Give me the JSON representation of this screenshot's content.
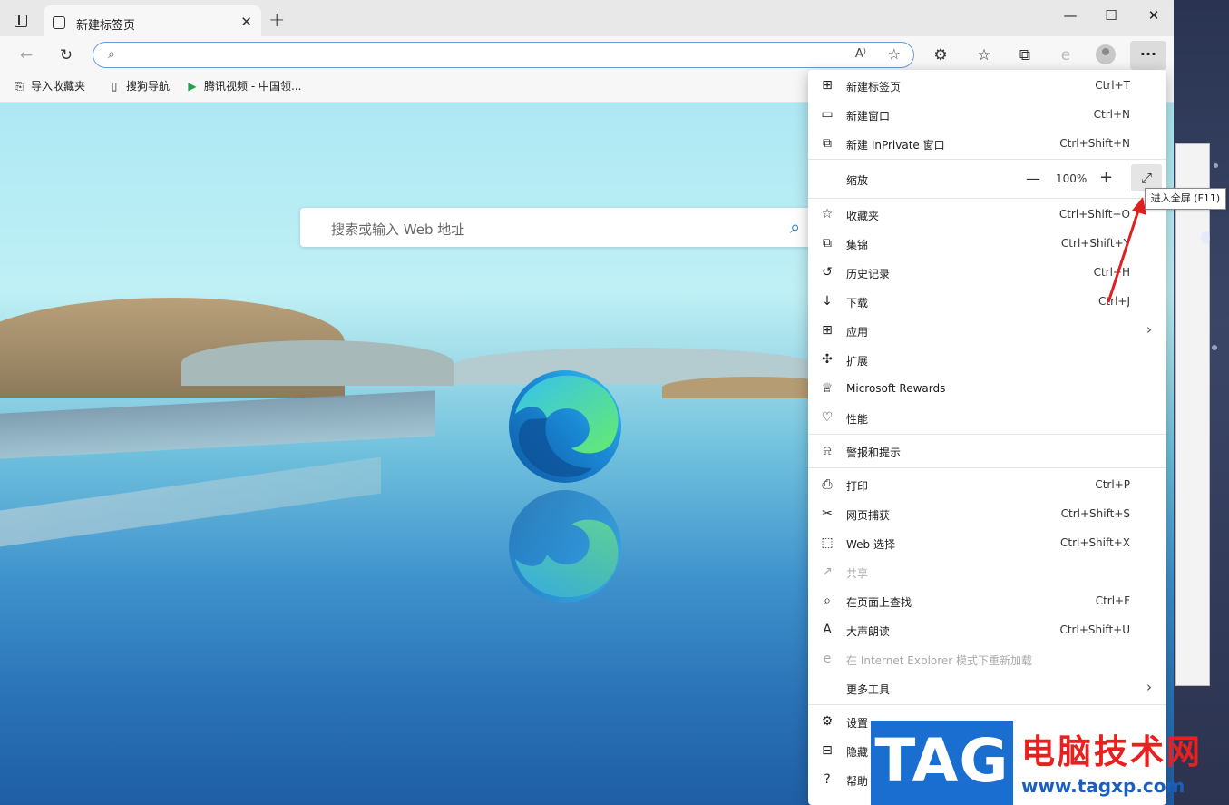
{
  "titlebar": {
    "tab_title": "新建标签页",
    "tab_close": "✕",
    "new_tab": "+",
    "minimize": "—",
    "maximize": "☐",
    "close": "✕"
  },
  "toolbar": {
    "back": "←",
    "refresh": "↻",
    "address_placeholder": "",
    "read_aloud": "A⁾",
    "favorite_add": "☆",
    "extensions": "⚙",
    "favorites": "☆",
    "collections": "⧉",
    "more": "···"
  },
  "bookmarks": [
    {
      "icon": "import-favorites-icon",
      "label": "导入收藏夹"
    },
    {
      "icon": "page-icon",
      "label": "搜狗导航"
    },
    {
      "icon": "tencent-video-icon",
      "label": "腾讯视频 - 中国领..."
    }
  ],
  "newtab": {
    "search_placeholder": "搜索或输入 Web 地址"
  },
  "menu": {
    "items_top": [
      {
        "icon": "new-tab-icon",
        "glyph": "⊞",
        "label": "新建标签页",
        "shortcut": "Ctrl+T"
      },
      {
        "icon": "new-window-icon",
        "glyph": "▭",
        "label": "新建窗口",
        "shortcut": "Ctrl+N"
      },
      {
        "icon": "inprivate-icon",
        "glyph": "⧉",
        "label": "新建 InPrivate 窗口",
        "shortcut": "Ctrl+Shift+N"
      }
    ],
    "zoom": {
      "label": "缩放",
      "minus": "—",
      "value": "100%",
      "plus": "+",
      "fullscreen": "⤢"
    },
    "items_mid": [
      {
        "icon": "favorites-icon",
        "glyph": "☆",
        "label": "收藏夹",
        "shortcut": "Ctrl+Shift+O"
      },
      {
        "icon": "collections-icon",
        "glyph": "⧉",
        "label": "集锦",
        "shortcut": "Ctrl+Shift+Y"
      },
      {
        "icon": "history-icon",
        "glyph": "↺",
        "label": "历史记录",
        "shortcut": "Ctrl+H"
      },
      {
        "icon": "download-icon",
        "glyph": "↓",
        "label": "下载",
        "shortcut": "Ctrl+J"
      },
      {
        "icon": "apps-icon",
        "glyph": "⊞",
        "label": "应用",
        "shortcut": "",
        "chevron": "›"
      },
      {
        "icon": "extensions-icon",
        "glyph": "✣",
        "label": "扩展",
        "shortcut": ""
      },
      {
        "icon": "rewards-icon",
        "glyph": "♕",
        "label": "Microsoft Rewards",
        "shortcut": ""
      },
      {
        "icon": "performance-icon",
        "glyph": "♡",
        "label": "性能",
        "shortcut": ""
      }
    ],
    "alerts": {
      "icon": "bell-icon",
      "glyph": "🔔︎",
      "label": "警报和提示"
    },
    "items_bottom": [
      {
        "icon": "print-icon",
        "glyph": "⎙",
        "label": "打印",
        "shortcut": "Ctrl+P",
        "disabled": false
      },
      {
        "icon": "web-capture-icon",
        "glyph": "✂",
        "label": "网页捕获",
        "shortcut": "Ctrl+Shift+S",
        "disabled": false
      },
      {
        "icon": "web-select-icon",
        "glyph": "⬚",
        "label": "Web 选择",
        "shortcut": "Ctrl+Shift+X",
        "disabled": false
      },
      {
        "icon": "share-icon",
        "glyph": "↗",
        "label": "共享",
        "shortcut": "",
        "disabled": true
      },
      {
        "icon": "find-icon",
        "glyph": "⌕",
        "label": "在页面上查找",
        "shortcut": "Ctrl+F",
        "disabled": false
      },
      {
        "icon": "read-aloud-icon",
        "glyph": "A",
        "label": "大声朗读",
        "shortcut": "Ctrl+Shift+U",
        "disabled": false
      },
      {
        "icon": "ie-mode-icon",
        "glyph": "e",
        "label": "在 Internet Explorer 模式下重新加载",
        "shortcut": "",
        "disabled": true
      },
      {
        "icon": "more-tools-icon",
        "glyph": "",
        "label": "更多工具",
        "shortcut": "",
        "chevron": "›",
        "disabled": false
      }
    ],
    "items_footer": [
      {
        "icon": "settings-icon",
        "glyph": "⚙",
        "label": "设置"
      },
      {
        "icon": "hide-sidebar-icon",
        "glyph": "⊟",
        "label": "隐藏"
      },
      {
        "icon": "help-icon",
        "glyph": "?",
        "label": "帮助"
      }
    ]
  },
  "tooltip": "进入全屏 (F11)",
  "watermark": {
    "tag": "TAG",
    "cn": "电脑技术网",
    "url": "www.tagxp.com"
  },
  "colors": {
    "accent": "#1a6ed0",
    "arrow": "#e02020",
    "watermark_red": "#e82020"
  }
}
